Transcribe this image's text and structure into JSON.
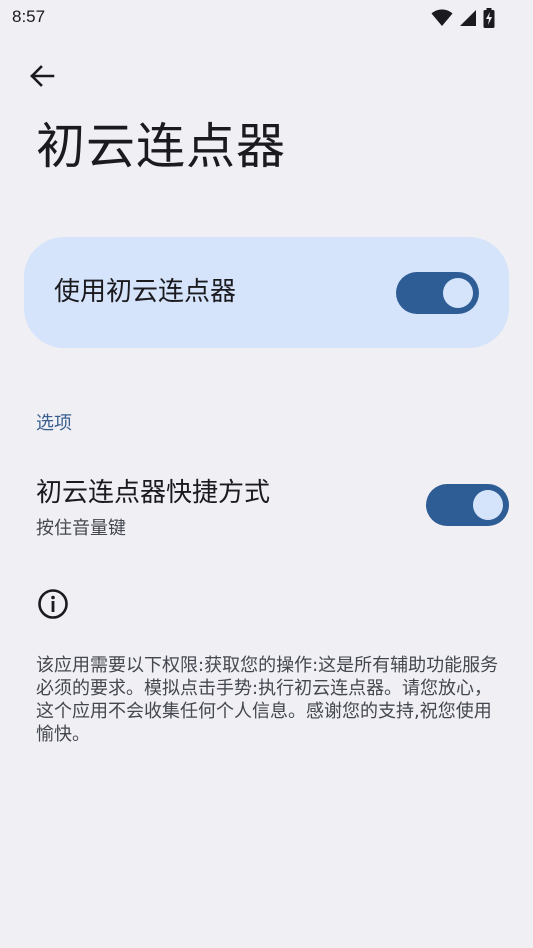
{
  "status_bar": {
    "time": "8:57",
    "icons": [
      "wifi-icon",
      "signal-icon",
      "battery-charging-icon"
    ]
  },
  "toolbar": {
    "back_icon": "arrow-back-icon"
  },
  "page": {
    "title": "初云连点器"
  },
  "main_switch": {
    "label": "使用初云连点器",
    "checked": true
  },
  "options": {
    "section_title": "选项",
    "shortcut": {
      "title": "初云连点器快捷方式",
      "subtitle": "按住音量键",
      "checked": true
    }
  },
  "info": {
    "icon": "info-icon",
    "text": "该应用需要以下权限:获取您的操作:这是所有辅助功能服务必须的要求。模拟点击手势:执行初云连点器。请您放心，这个应用不会收集任何个人信息。感谢您的支持,祝您使用愉快。"
  },
  "colors": {
    "background": "#efeff4",
    "card": "#d5e3fb",
    "accent": "#2e5d95",
    "section_header": "#3a5f8f"
  }
}
